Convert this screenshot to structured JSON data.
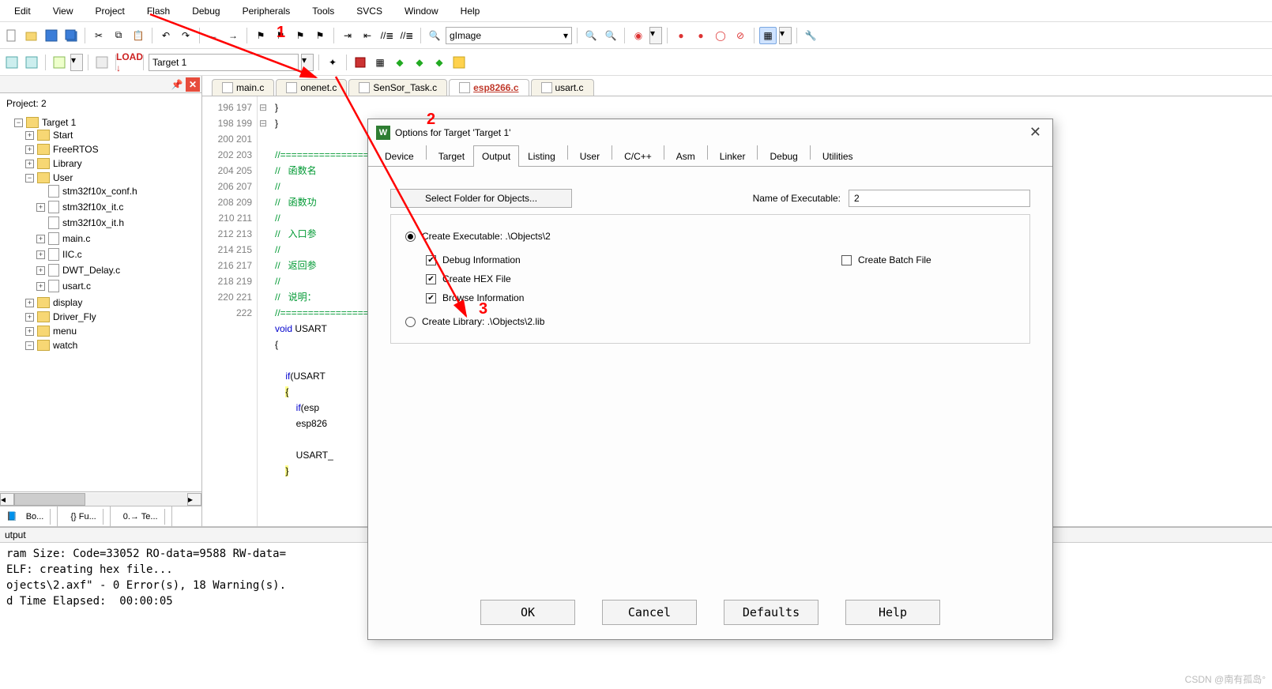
{
  "menu": [
    "Edit",
    "View",
    "Project",
    "Flash",
    "Debug",
    "Peripherals",
    "Tools",
    "SVCS",
    "Window",
    "Help"
  ],
  "toolbar1": {
    "search_text": "gImage"
  },
  "toolbar2": {
    "target": "Target 1"
  },
  "project": {
    "title": "Project: 2",
    "root": "Target 1",
    "nodes": [
      {
        "t": "folder",
        "exp": "+",
        "label": "Start"
      },
      {
        "t": "folder",
        "exp": "+",
        "label": "FreeRTOS"
      },
      {
        "t": "folder",
        "exp": "+",
        "label": "Library"
      },
      {
        "t": "folder",
        "exp": "-",
        "label": "User",
        "children": [
          {
            "t": "file",
            "exp": "",
            "label": "stm32f10x_conf.h"
          },
          {
            "t": "file",
            "exp": "+",
            "label": "stm32f10x_it.c"
          },
          {
            "t": "file",
            "exp": "",
            "label": "stm32f10x_it.h"
          },
          {
            "t": "file",
            "exp": "+",
            "label": "main.c"
          },
          {
            "t": "file",
            "exp": "+",
            "label": "IIC.c"
          },
          {
            "t": "file",
            "exp": "+",
            "label": "DWT_Delay.c"
          },
          {
            "t": "file",
            "exp": "+",
            "label": "usart.c"
          }
        ]
      },
      {
        "t": "folder",
        "exp": "+",
        "label": "display"
      },
      {
        "t": "folder",
        "exp": "+",
        "label": "Driver_Fly"
      },
      {
        "t": "folder",
        "exp": "+",
        "label": "menu"
      },
      {
        "t": "folder",
        "exp": "-",
        "label": "watch"
      }
    ],
    "tabs": [
      "Bo...",
      "{} Fu...",
      "0.→ Te..."
    ]
  },
  "editor": {
    "tabs": [
      {
        "name": "main.c",
        "active": false
      },
      {
        "name": "onenet.c",
        "active": false
      },
      {
        "name": "SenSor_Task.c",
        "active": false
      },
      {
        "name": "esp8266.c",
        "active": true
      },
      {
        "name": "usart.c",
        "active": false
      }
    ],
    "first_line": 196,
    "lines": [
      "}",
      "}",
      "",
      "//==========================================================",
      "//   函数名",
      "//",
      "//   函数功",
      "//",
      "//   入口参",
      "//",
      "//   返回参",
      "//",
      "//   说明：",
      "//==========================================================",
      "void USART",
      "{",
      "",
      "    if(USART",
      "    {",
      "        if(esp",
      "        esp826",
      "",
      "        USART_",
      "    }",
      "",
      "",
      ""
    ]
  },
  "output": {
    "title": "utput",
    "lines": [
      "ram Size: Code=33052 RO-data=9588 RW-data=",
      "ELF: creating hex file...",
      "ojects\\2.axf\" - 0 Error(s), 18 Warning(s).",
      "d Time Elapsed:  00:00:05"
    ]
  },
  "dialog": {
    "title": "Options for Target 'Target 1'",
    "tabs": [
      "Device",
      "Target",
      "Output",
      "Listing",
      "User",
      "C/C++",
      "Asm",
      "Linker",
      "Debug",
      "Utilities"
    ],
    "active_tab": "Output",
    "select_folder_btn": "Select Folder for Objects...",
    "name_label": "Name of Executable:",
    "name_value": "2",
    "radio_exe": "Create Executable:  .\\Objects\\2",
    "chk_debug": "Debug Information",
    "chk_hex": "Create HEX File",
    "chk_browse": "Browse Information",
    "chk_batch": "Create Batch File",
    "radio_lib": "Create Library:   .\\Objects\\2.lib",
    "buttons": [
      "OK",
      "Cancel",
      "Defaults",
      "Help"
    ]
  },
  "annotations": {
    "n1": "1",
    "n2": "2",
    "n3": "3"
  },
  "watermark": "CSDN @南有孤岛°"
}
